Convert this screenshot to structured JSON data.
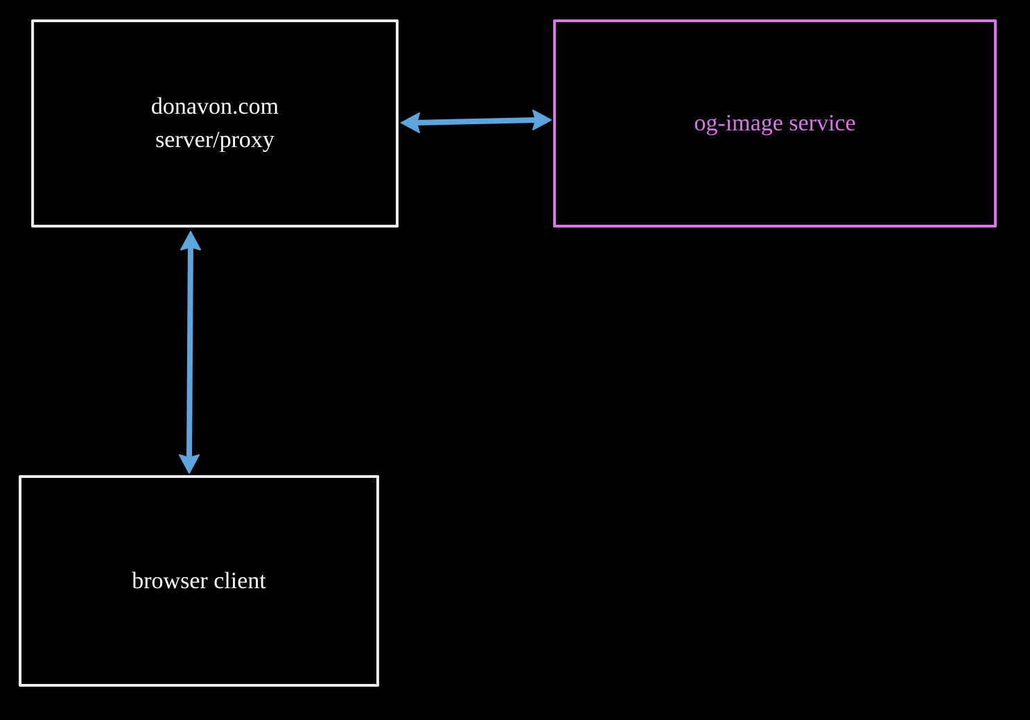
{
  "boxes": {
    "server": {
      "line1": "donavon.com",
      "line2": "server/proxy"
    },
    "og_image": {
      "label": "og-image service"
    },
    "browser": {
      "label": "browser client"
    }
  },
  "colors": {
    "background": "#000000",
    "box_stroke_default": "#ececec",
    "box_stroke_accent": "#d877e8",
    "text_default": "#ffffff",
    "text_accent": "#d877e8",
    "arrow": "#5ea5dd"
  },
  "arrows": [
    {
      "from": "server",
      "to": "og_image",
      "bidirectional": true
    },
    {
      "from": "server",
      "to": "browser",
      "bidirectional": true
    }
  ]
}
